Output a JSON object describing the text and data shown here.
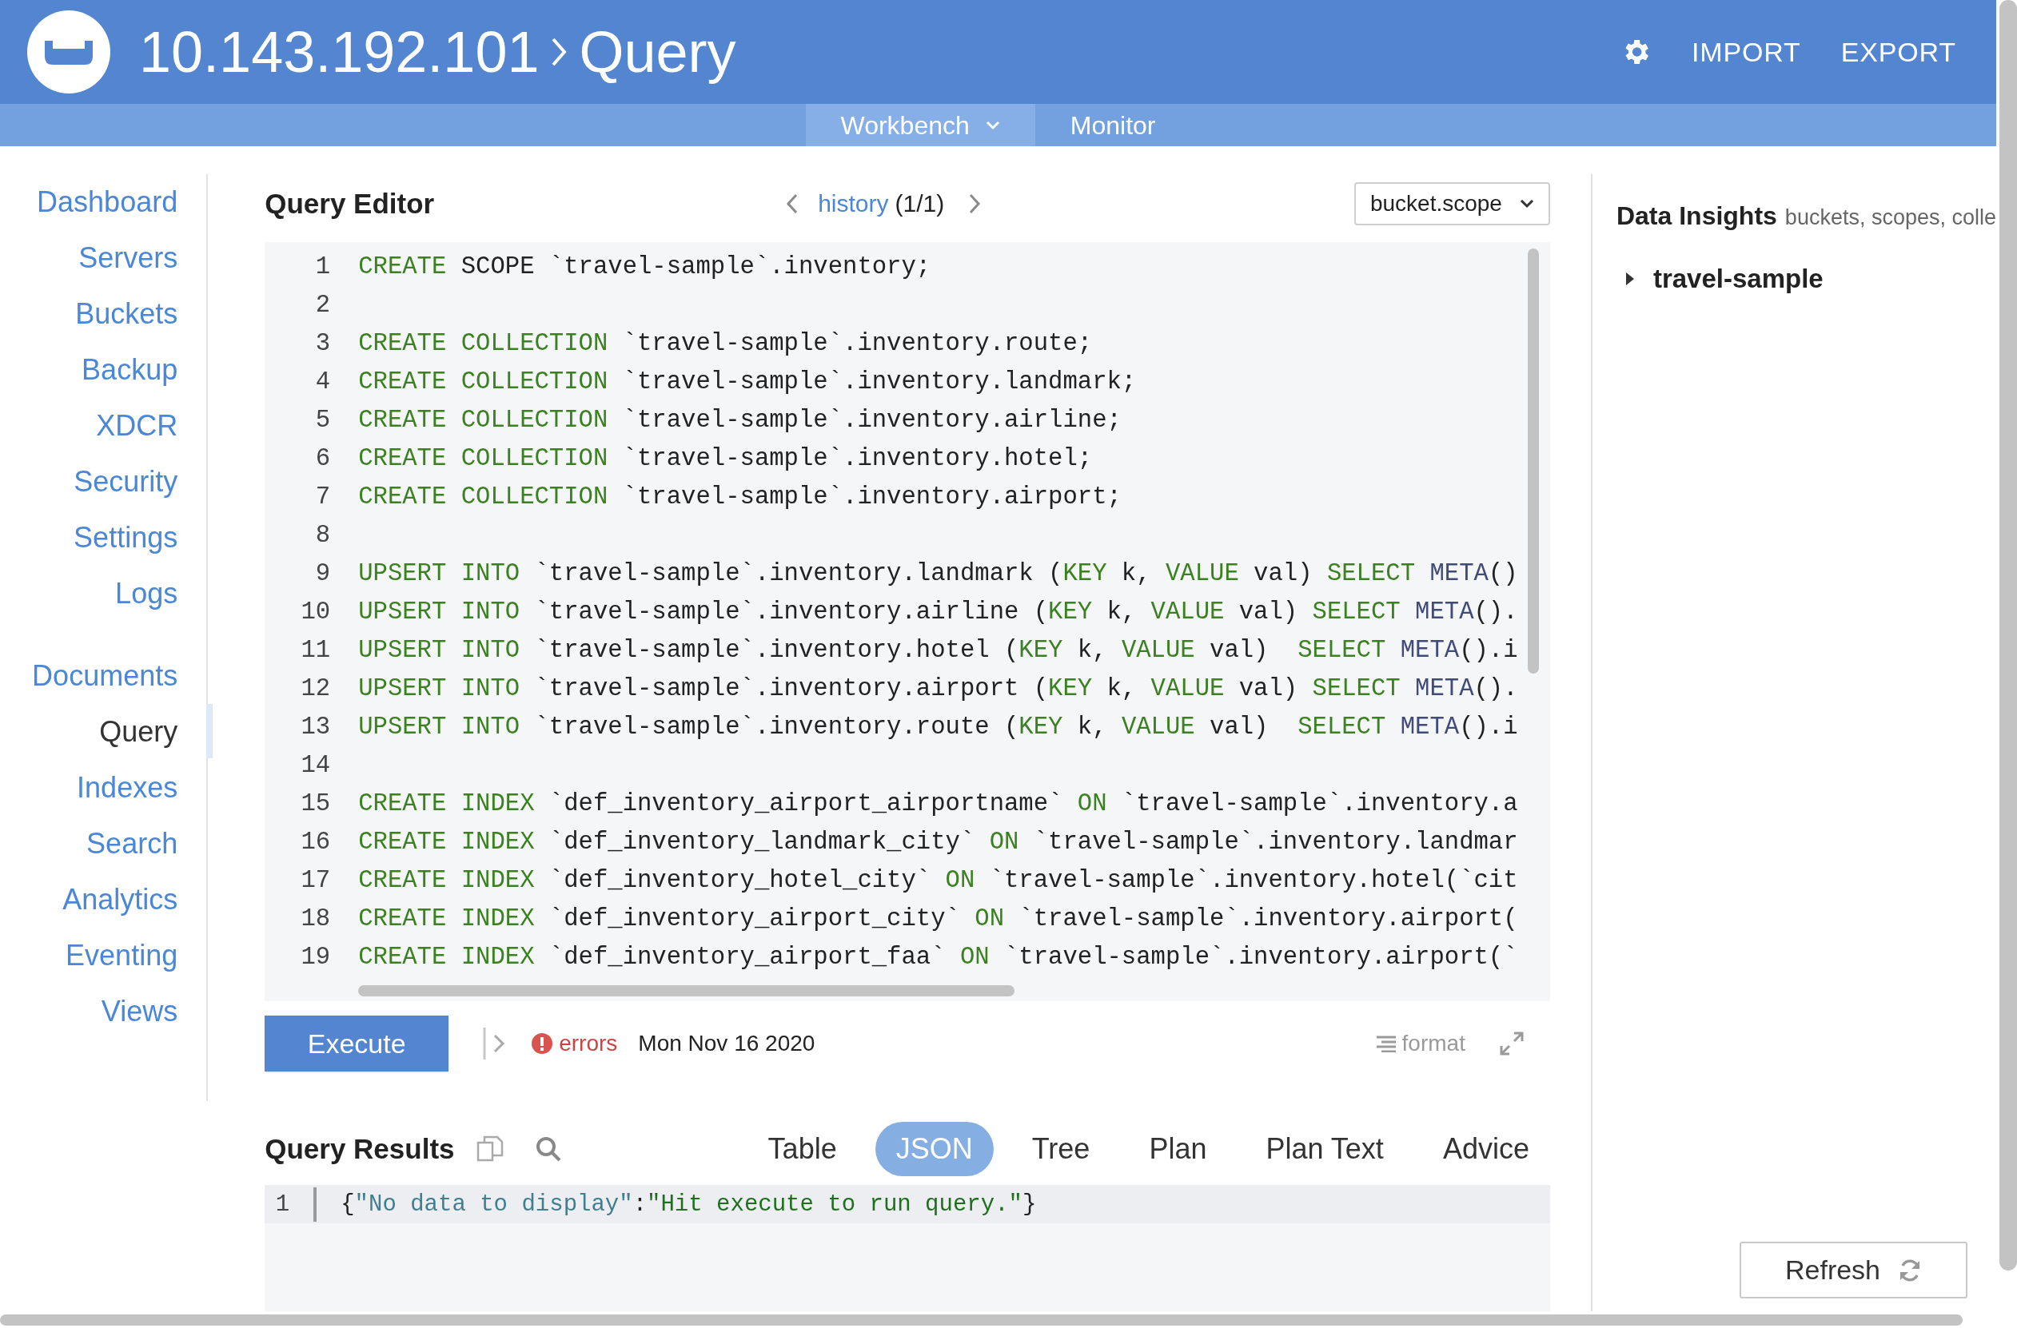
{
  "header": {
    "breadcrumb": [
      "10.143.192.101",
      "Query"
    ],
    "actions": [
      "IMPORT",
      "EXPORT"
    ]
  },
  "subnav": [
    {
      "label": "Workbench",
      "selected": true,
      "has_menu": true
    },
    {
      "label": "Monitor",
      "selected": false,
      "has_menu": false
    }
  ],
  "sidebar": {
    "groups": [
      [
        {
          "label": "Dashboard",
          "selected": false
        },
        {
          "label": "Servers",
          "selected": false
        },
        {
          "label": "Buckets",
          "selected": false
        },
        {
          "label": "Backup",
          "selected": false
        },
        {
          "label": "XDCR",
          "selected": false
        },
        {
          "label": "Security",
          "selected": false
        },
        {
          "label": "Settings",
          "selected": false
        },
        {
          "label": "Logs",
          "selected": false
        }
      ],
      [
        {
          "label": "Documents",
          "selected": false
        },
        {
          "label": "Query",
          "selected": true
        },
        {
          "label": "Indexes",
          "selected": false
        },
        {
          "label": "Search",
          "selected": false
        },
        {
          "label": "Analytics",
          "selected": false
        },
        {
          "label": "Eventing",
          "selected": false
        },
        {
          "label": "Views",
          "selected": false
        }
      ]
    ]
  },
  "editor": {
    "title": "Query Editor",
    "history": {
      "link": "history",
      "count": "(1/1)"
    },
    "scope_select": "bucket.scope",
    "lines": [
      {
        "number": "1",
        "tokens": [
          {
            "kind": "keyword",
            "text": "CREATE"
          },
          {
            "kind": "plain",
            "text": " SCOPE `travel-sample`.inventory;"
          }
        ]
      },
      {
        "number": "2"
      },
      {
        "number": "3",
        "tokens": [
          {
            "kind": "keyword",
            "text": "CREATE COLLECTION"
          },
          {
            "kind": "plain",
            "text": " `travel-sample`.inventory.route;"
          }
        ]
      },
      {
        "number": "4",
        "tokens": [
          {
            "kind": "keyword",
            "text": "CREATE COLLECTION"
          },
          {
            "kind": "plain",
            "text": " `travel-sample`.inventory.landmark;"
          }
        ]
      },
      {
        "number": "5",
        "tokens": [
          {
            "kind": "keyword",
            "text": "CREATE COLLECTION"
          },
          {
            "kind": "plain",
            "text": " `travel-sample`.inventory.airline;"
          }
        ]
      },
      {
        "number": "6",
        "tokens": [
          {
            "kind": "keyword",
            "text": "CREATE COLLECTION"
          },
          {
            "kind": "plain",
            "text": " `travel-sample`.inventory.hotel;"
          }
        ]
      },
      {
        "number": "7",
        "tokens": [
          {
            "kind": "keyword",
            "text": "CREATE COLLECTION"
          },
          {
            "kind": "plain",
            "text": " `travel-sample`.inventory.airport;"
          }
        ]
      },
      {
        "number": "8"
      },
      {
        "number": "9",
        "tokens": [
          {
            "kind": "keyword",
            "text": "UPSERT INTO"
          },
          {
            "kind": "plain",
            "text": " `travel-sample`.inventory.landmark ("
          },
          {
            "kind": "keyword",
            "text": "KEY"
          },
          {
            "kind": "plain",
            "text": " k, "
          },
          {
            "kind": "keyword",
            "text": "VALUE"
          },
          {
            "kind": "plain",
            "text": " val) "
          },
          {
            "kind": "keyword",
            "text": "SELECT "
          },
          {
            "kind": "function",
            "text": "META"
          },
          {
            "kind": "plain",
            "text": "()"
          }
        ]
      },
      {
        "number": "10",
        "tokens": [
          {
            "kind": "keyword",
            "text": "UPSERT INTO"
          },
          {
            "kind": "plain",
            "text": " `travel-sample`.inventory.airline ("
          },
          {
            "kind": "keyword",
            "text": "KEY"
          },
          {
            "kind": "plain",
            "text": " k, "
          },
          {
            "kind": "keyword",
            "text": "VALUE"
          },
          {
            "kind": "plain",
            "text": " val) "
          },
          {
            "kind": "keyword",
            "text": "SELECT "
          },
          {
            "kind": "function",
            "text": "META"
          },
          {
            "kind": "plain",
            "text": "()."
          }
        ]
      },
      {
        "number": "11",
        "tokens": [
          {
            "kind": "keyword",
            "text": "UPSERT INTO"
          },
          {
            "kind": "plain",
            "text": " `travel-sample`.inventory.hotel ("
          },
          {
            "kind": "keyword",
            "text": "KEY"
          },
          {
            "kind": "plain",
            "text": " k, "
          },
          {
            "kind": "keyword",
            "text": "VALUE"
          },
          {
            "kind": "plain",
            "text": " val)  "
          },
          {
            "kind": "keyword",
            "text": "SELECT "
          },
          {
            "kind": "function",
            "text": "META"
          },
          {
            "kind": "plain",
            "text": "().i"
          }
        ]
      },
      {
        "number": "12",
        "tokens": [
          {
            "kind": "keyword",
            "text": "UPSERT INTO"
          },
          {
            "kind": "plain",
            "text": " `travel-sample`.inventory.airport ("
          },
          {
            "kind": "keyword",
            "text": "KEY"
          },
          {
            "kind": "plain",
            "text": " k, "
          },
          {
            "kind": "keyword",
            "text": "VALUE"
          },
          {
            "kind": "plain",
            "text": " val) "
          },
          {
            "kind": "keyword",
            "text": "SELECT "
          },
          {
            "kind": "function",
            "text": "META"
          },
          {
            "kind": "plain",
            "text": "()."
          }
        ]
      },
      {
        "number": "13",
        "tokens": [
          {
            "kind": "keyword",
            "text": "UPSERT INTO"
          },
          {
            "kind": "plain",
            "text": " `travel-sample`.inventory.route ("
          },
          {
            "kind": "keyword",
            "text": "KEY"
          },
          {
            "kind": "plain",
            "text": " k, "
          },
          {
            "kind": "keyword",
            "text": "VALUE"
          },
          {
            "kind": "plain",
            "text": " val)  "
          },
          {
            "kind": "keyword",
            "text": "SELECT "
          },
          {
            "kind": "function",
            "text": "META"
          },
          {
            "kind": "plain",
            "text": "().i"
          }
        ]
      },
      {
        "number": "14"
      },
      {
        "number": "15",
        "tokens": [
          {
            "kind": "keyword",
            "text": "CREATE INDEX"
          },
          {
            "kind": "plain",
            "text": " `def_inventory_airport_airportname` "
          },
          {
            "kind": "keyword",
            "text": "ON"
          },
          {
            "kind": "plain",
            "text": " `travel-sample`.inventory.a"
          }
        ]
      },
      {
        "number": "16",
        "tokens": [
          {
            "kind": "keyword",
            "text": "CREATE INDEX"
          },
          {
            "kind": "plain",
            "text": " `def_inventory_landmark_city` "
          },
          {
            "kind": "keyword",
            "text": "ON"
          },
          {
            "kind": "plain",
            "text": " `travel-sample`.inventory.landmar"
          }
        ]
      },
      {
        "number": "17",
        "tokens": [
          {
            "kind": "keyword",
            "text": "CREATE INDEX"
          },
          {
            "kind": "plain",
            "text": " `def_inventory_hotel_city` "
          },
          {
            "kind": "keyword",
            "text": "ON"
          },
          {
            "kind": "plain",
            "text": " `travel-sample`.inventory.hotel(`cit"
          }
        ]
      },
      {
        "number": "18",
        "tokens": [
          {
            "kind": "keyword",
            "text": "CREATE INDEX"
          },
          {
            "kind": "plain",
            "text": " `def_inventory_airport_city` "
          },
          {
            "kind": "keyword",
            "text": "ON"
          },
          {
            "kind": "plain",
            "text": " `travel-sample`.inventory.airport("
          }
        ]
      },
      {
        "number": "19",
        "tokens": [
          {
            "kind": "keyword",
            "text": "CREATE INDEX"
          },
          {
            "kind": "plain",
            "text": " `def_inventory_airport_faa` "
          },
          {
            "kind": "keyword",
            "text": "ON"
          },
          {
            "kind": "plain",
            "text": " `travel-sample`.inventory.airport(`"
          }
        ]
      }
    ]
  },
  "toolbar": {
    "execute": "Execute",
    "status": "errors",
    "timestamp": "Mon Nov 16 2020",
    "format": "format"
  },
  "results": {
    "title": "Query Results",
    "tabs": [
      {
        "label": "Table",
        "selected": false
      },
      {
        "label": "JSON",
        "selected": true
      },
      {
        "label": "Tree",
        "selected": false
      },
      {
        "label": "Plan",
        "selected": false
      },
      {
        "label": "Plan Text",
        "selected": false
      },
      {
        "label": "Advice",
        "selected": false
      }
    ],
    "lines": [
      {
        "number": "1",
        "tokens": [
          {
            "kind": "plain",
            "text": "{"
          },
          {
            "kind": "key",
            "text": "\"No data to display\""
          },
          {
            "kind": "plain",
            "text": ":"
          },
          {
            "kind": "string",
            "text": "\"Hit execute to run query.\""
          },
          {
            "kind": "plain",
            "text": "}"
          }
        ]
      }
    ]
  },
  "insights": {
    "title": "Data Insights",
    "subtitle": "buckets, scopes, colle",
    "tree": [
      {
        "label": "travel-sample",
        "expanded": false
      }
    ],
    "refresh": "Refresh"
  }
}
